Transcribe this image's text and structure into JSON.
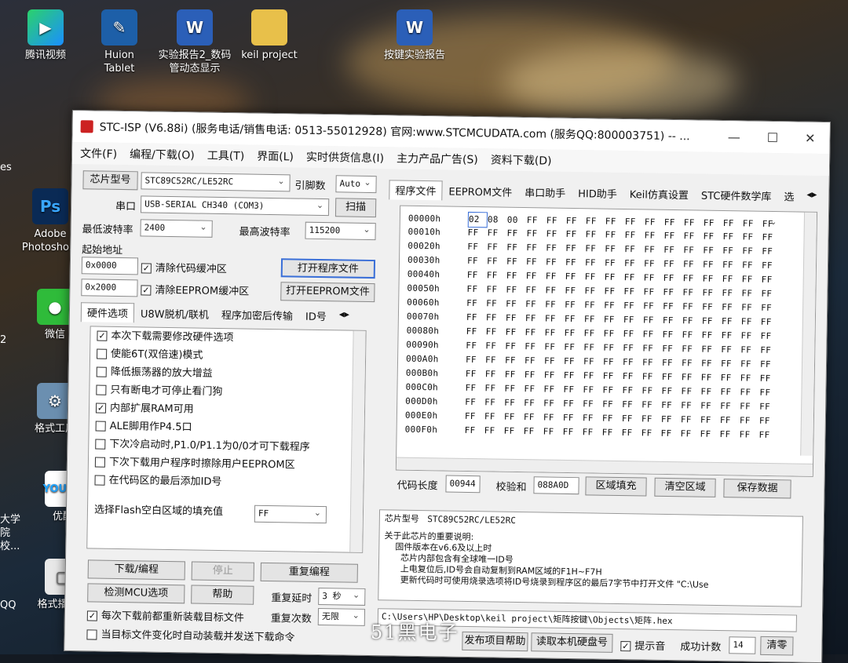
{
  "desktop": {
    "icons": [
      {
        "label": "腾讯视频",
        "icon": "tencent-video-icon"
      },
      {
        "label": "Huion Tablet",
        "icon": "huion-tablet-icon"
      },
      {
        "label": "实验报告2_数码管动态显示",
        "icon": "word-doc-icon"
      },
      {
        "label": "keil project",
        "icon": "folder-icon"
      },
      {
        "label": "按键实验报告",
        "icon": "word-doc-icon"
      },
      {
        "label": "Adobe Photosho...",
        "icon": "photoshop-icon"
      },
      {
        "label": "微信",
        "icon": "wechat-icon"
      },
      {
        "label": "格式工厂",
        "icon": "format-factory-icon"
      },
      {
        "label": "优酷",
        "icon": "youku-icon"
      },
      {
        "label": "格式播放器",
        "icon": "format-player-icon"
      }
    ],
    "left_edge_labels": [
      "es",
      "2",
      "大学 院校...",
      "QQ"
    ]
  },
  "window": {
    "title": "STC-ISP (V6.88i) (服务电话/销售电话: 0513-55012928) 官网:www.STCMCUDATA.com (服务QQ:800003751) -- ...",
    "controls": {
      "minimize": "—",
      "maximize": "☐",
      "close": "✕"
    },
    "menu": [
      "文件(F)",
      "编程/下载(O)",
      "工具(T)",
      "界面(L)",
      "实时供货信息(I)",
      "主力产品广告(S)",
      "资料下载(D)"
    ]
  },
  "left": {
    "chip_label": "芯片型号",
    "chip_value": "STC89C52RC/LE52RC",
    "pins_label": "引脚数",
    "pins_value": "Auto",
    "port_label": "串口",
    "port_value": "USB-SERIAL CH340 (COM3)",
    "scan_button": "扫描",
    "min_baud_label": "最低波特率",
    "min_baud_value": "2400",
    "max_baud_label": "最高波特率",
    "max_baud_value": "115200",
    "start_addr_label": "起始地址",
    "addr1": "0x0000",
    "clear_code_label": "清除代码缓冲区",
    "open_prog_button": "打开程序文件",
    "addr2": "0x2000",
    "clear_eeprom_label": "清除EEPROM缓冲区",
    "open_eeprom_button": "打开EEPROM文件",
    "tabs": [
      "硬件选项",
      "U8W脱机/联机",
      "程序加密后传输",
      "ID号"
    ],
    "options": [
      {
        "label": "本次下载需要修改硬件选项",
        "checked": true
      },
      {
        "label": "使能6T(双倍速)模式",
        "checked": false
      },
      {
        "label": "降低振荡器的放大增益",
        "checked": false
      },
      {
        "label": "只有断电才可停止看门狗",
        "checked": false
      },
      {
        "label": "内部扩展RAM可用",
        "checked": true
      },
      {
        "label": "ALE脚用作P4.5口",
        "checked": false
      },
      {
        "label": "下次冷启动时,P1.0/P1.1为0/0才可下载程序",
        "checked": false
      },
      {
        "label": "下次下载用户程序时擦除用户EEPROM区",
        "checked": false
      },
      {
        "label": "在代码区的最后添加ID号",
        "checked": false
      }
    ],
    "fill_label": "选择Flash空白区域的填充值",
    "fill_value": "FF",
    "download_button": "下载/编程",
    "stop_button": "停止",
    "reprogram_button": "重复编程",
    "detect_button": "检测MCU选项",
    "help_button": "帮助",
    "repeat_delay_label": "重复延时",
    "repeat_delay_value": "3 秒",
    "repeat_count_label": "重复次数",
    "repeat_count_value": "无限",
    "reload_label": "每次下载前都重新装载目标文件",
    "reload_checked": true,
    "auto_label": "当目标文件变化时自动装载并发送下载命令",
    "auto_checked": false
  },
  "right": {
    "tabs": [
      "程序文件",
      "EEPROM文件",
      "串口助手",
      "HID助手",
      "Keil仿真设置",
      "STC硬件数学库",
      "选"
    ],
    "hex_rows": [
      {
        "addr": "00000h",
        "bytes": [
          "02",
          "08",
          "00",
          "FF",
          "FF",
          "FF",
          "FF",
          "FF",
          "FF",
          "FF",
          "FF",
          "FF",
          "FF",
          "FF",
          "FF",
          "FF"
        ]
      },
      {
        "addr": "00010h",
        "bytes": [
          "FF",
          "FF",
          "FF",
          "FF",
          "FF",
          "FF",
          "FF",
          "FF",
          "FF",
          "FF",
          "FF",
          "FF",
          "FF",
          "FF",
          "FF",
          "FF"
        ]
      },
      {
        "addr": "00020h",
        "bytes": [
          "FF",
          "FF",
          "FF",
          "FF",
          "FF",
          "FF",
          "FF",
          "FF",
          "FF",
          "FF",
          "FF",
          "FF",
          "FF",
          "FF",
          "FF",
          "FF"
        ]
      },
      {
        "addr": "00030h",
        "bytes": [
          "FF",
          "FF",
          "FF",
          "FF",
          "FF",
          "FF",
          "FF",
          "FF",
          "FF",
          "FF",
          "FF",
          "FF",
          "FF",
          "FF",
          "FF",
          "FF"
        ]
      },
      {
        "addr": "00040h",
        "bytes": [
          "FF",
          "FF",
          "FF",
          "FF",
          "FF",
          "FF",
          "FF",
          "FF",
          "FF",
          "FF",
          "FF",
          "FF",
          "FF",
          "FF",
          "FF",
          "FF"
        ]
      },
      {
        "addr": "00050h",
        "bytes": [
          "FF",
          "FF",
          "FF",
          "FF",
          "FF",
          "FF",
          "FF",
          "FF",
          "FF",
          "FF",
          "FF",
          "FF",
          "FF",
          "FF",
          "FF",
          "FF"
        ]
      },
      {
        "addr": "00060h",
        "bytes": [
          "FF",
          "FF",
          "FF",
          "FF",
          "FF",
          "FF",
          "FF",
          "FF",
          "FF",
          "FF",
          "FF",
          "FF",
          "FF",
          "FF",
          "FF",
          "FF"
        ]
      },
      {
        "addr": "00070h",
        "bytes": [
          "FF",
          "FF",
          "FF",
          "FF",
          "FF",
          "FF",
          "FF",
          "FF",
          "FF",
          "FF",
          "FF",
          "FF",
          "FF",
          "FF",
          "FF",
          "FF"
        ]
      },
      {
        "addr": "00080h",
        "bytes": [
          "FF",
          "FF",
          "FF",
          "FF",
          "FF",
          "FF",
          "FF",
          "FF",
          "FF",
          "FF",
          "FF",
          "FF",
          "FF",
          "FF",
          "FF",
          "FF"
        ]
      },
      {
        "addr": "00090h",
        "bytes": [
          "FF",
          "FF",
          "FF",
          "FF",
          "FF",
          "FF",
          "FF",
          "FF",
          "FF",
          "FF",
          "FF",
          "FF",
          "FF",
          "FF",
          "FF",
          "FF"
        ]
      },
      {
        "addr": "000A0h",
        "bytes": [
          "FF",
          "FF",
          "FF",
          "FF",
          "FF",
          "FF",
          "FF",
          "FF",
          "FF",
          "FF",
          "FF",
          "FF",
          "FF",
          "FF",
          "FF",
          "FF"
        ]
      },
      {
        "addr": "000B0h",
        "bytes": [
          "FF",
          "FF",
          "FF",
          "FF",
          "FF",
          "FF",
          "FF",
          "FF",
          "FF",
          "FF",
          "FF",
          "FF",
          "FF",
          "FF",
          "FF",
          "FF"
        ]
      },
      {
        "addr": "000C0h",
        "bytes": [
          "FF",
          "FF",
          "FF",
          "FF",
          "FF",
          "FF",
          "FF",
          "FF",
          "FF",
          "FF",
          "FF",
          "FF",
          "FF",
          "FF",
          "FF",
          "FF"
        ]
      },
      {
        "addr": "000D0h",
        "bytes": [
          "FF",
          "FF",
          "FF",
          "FF",
          "FF",
          "FF",
          "FF",
          "FF",
          "FF",
          "FF",
          "FF",
          "FF",
          "FF",
          "FF",
          "FF",
          "FF"
        ]
      },
      {
        "addr": "000E0h",
        "bytes": [
          "FF",
          "FF",
          "FF",
          "FF",
          "FF",
          "FF",
          "FF",
          "FF",
          "FF",
          "FF",
          "FF",
          "FF",
          "FF",
          "FF",
          "FF",
          "FF"
        ]
      },
      {
        "addr": "000F0h",
        "bytes": [
          "FF",
          "FF",
          "FF",
          "FF",
          "FF",
          "FF",
          "FF",
          "FF",
          "FF",
          "FF",
          "FF",
          "FF",
          "FF",
          "FF",
          "FF",
          "FF"
        ]
      }
    ],
    "code_len_label": "代码长度",
    "code_len_value": "00944",
    "checksum_label": "校验和",
    "checksum_value": "088A0D",
    "fill_area_button": "区域填充",
    "clear_area_button": "清空区域",
    "save_button": "保存数据",
    "info_chip_label": "芯片型号",
    "info_chip_value": "STC89C52RC/LE52RC",
    "info_lines": [
      "关于此芯片的重要说明:",
      "    固件版本在v6.6及以上时",
      "      芯片内部包含有全球唯一ID号",
      "      上电复位后,ID号会自动复制到RAM区域的F1H~F7H",
      "      更新代码时可使用烧录选项将ID号烧录到程序区的最后7字节中打开文件 \"C:\\Use"
    ],
    "path": "C:\\Users\\HP\\Desktop\\keil project\\矩阵按键\\Objects\\矩阵.hex",
    "help_button": "发布项目帮助",
    "read_disk_button": "读取本机硬盘号",
    "sound_label": "提示音",
    "sound_checked": true,
    "success_label": "成功计数",
    "success_value": "14",
    "clear_button": "清零"
  },
  "watermark": "51黑电子"
}
